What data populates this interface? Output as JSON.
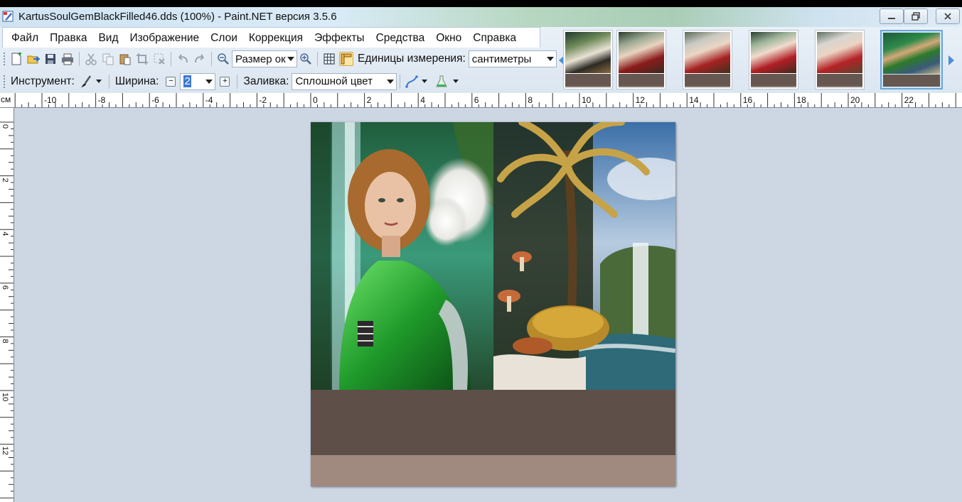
{
  "window": {
    "title": "KartusSoulGemBlackFilled46.dds (100%) - Paint.NET версия 3.5.6"
  },
  "menu": {
    "items": [
      "Файл",
      "Правка",
      "Вид",
      "Изображение",
      "Слои",
      "Коррекция",
      "Эффекты",
      "Средства",
      "Окно",
      "Справка"
    ]
  },
  "toolbar": {
    "zoom_value": "Размер ок",
    "units_label": "Единицы измерения:",
    "units_value": "сантиметры"
  },
  "tool_options": {
    "tool_label": "Инструмент:",
    "width_label": "Ширина:",
    "width_value": "2",
    "fill_label": "Заливка:",
    "fill_value": "Сплошной цвет"
  },
  "ruler": {
    "unit": "см",
    "h_labels": [
      "-10",
      "-8",
      "-6",
      "-4",
      "-2",
      "0",
      "2",
      "4",
      "6",
      "8",
      "10",
      "12",
      "14",
      "16",
      "18",
      "20",
      "22"
    ],
    "v_labels": [
      "0",
      "2",
      "4",
      "6",
      "8",
      "10",
      "12"
    ]
  },
  "thumbnails": {
    "count": 6,
    "selected_index": 5
  },
  "colors": {
    "workspace": "#cdd6e3",
    "bottom_band_dark": "#5e4f49",
    "bottom_band_light": "#a08a80"
  }
}
